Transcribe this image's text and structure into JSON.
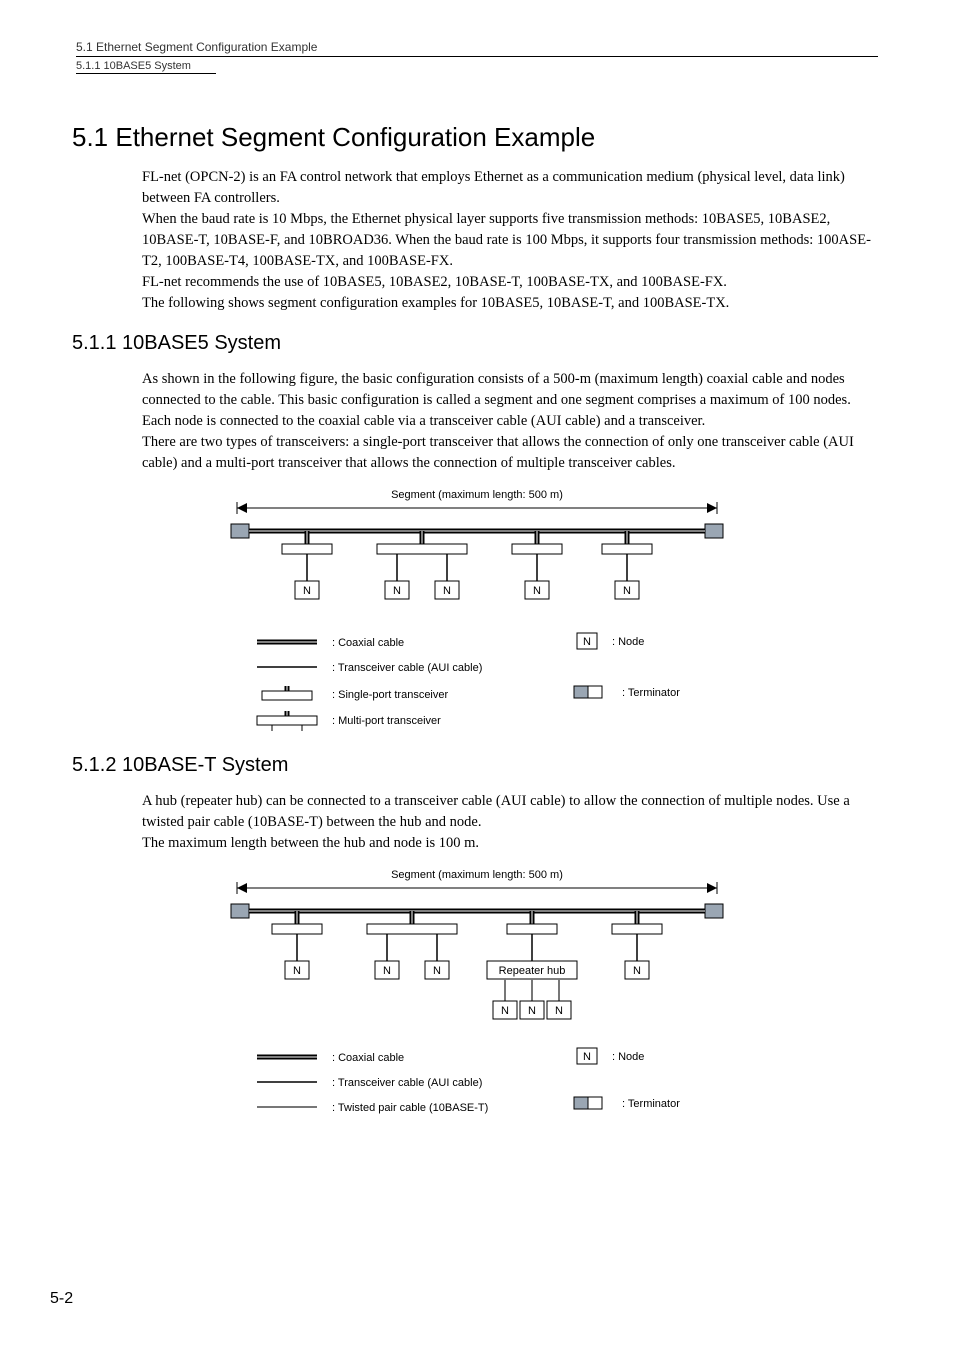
{
  "header": {
    "running_head": "5.1  Ethernet Segment Configuration Example",
    "running_sub": "5.1.1  10BASE5 System"
  },
  "section": {
    "heading": "5.1  Ethernet Segment Configuration Example",
    "para": "FL-net (OPCN-2) is an FA control network that employs Ethernet as a communication medium (physical level, data link) between FA controllers.\nWhen the baud rate is 10 Mbps, the Ethernet physical layer supports five transmission methods: 10BASE5, 10BASE2, 10BASE-T, 10BASE-F, and 10BROAD36. When the baud rate is 100 Mbps, it supports four transmission methods: 100ASE-T2, 100BASE-T4, 100BASE-TX, and 100BASE-FX.\nFL-net recommends the use of 10BASE5, 10BASE2, 10BASE-T, 100BASE-TX, and 100BASE-FX.\nThe following shows segment configuration examples for 10BASE5, 10BASE-T, and 100BASE-TX."
  },
  "sub1": {
    "heading": "5.1.1  10BASE5 System",
    "para": "As shown in the following figure, the basic configuration consists of a 500-m (maximum length) coaxial cable and nodes connected to the cable. This basic configuration is called a segment and one segment comprises a maximum of 100 nodes.\nEach node is connected to the coaxial cable via a transceiver cable (AUI cable) and a transceiver.\nThere are two types of transceivers: a single-port transceiver that allows the connection of only one transceiver cable (AUI cable) and a multi-port transceiver that allows the connection of multiple transceiver cables."
  },
  "sub2": {
    "heading": "5.1.2  10BASE-T System",
    "para": "A hub (repeater hub) can be connected to a transceiver cable (AUI cable) to allow the connection of multiple nodes. Use a twisted pair cable (10BASE-T) between the hub and node.\nThe maximum length between the hub and node is 100 m."
  },
  "diagram": {
    "segment_label": "Segment (maximum length: 500 m)",
    "node_letter": "N",
    "hub_label": "Repeater hub",
    "legend": {
      "coax": ": Coaxial cable",
      "aui": ": Transceiver cable (AUI cable)",
      "single": ": Single-port transceiver",
      "multi": ": Multi-port transceiver",
      "twisted": ": Twisted pair cable (10BASE-T)",
      "node": ": Node",
      "terminator": ": Terminator"
    }
  },
  "page_number": "5-2"
}
